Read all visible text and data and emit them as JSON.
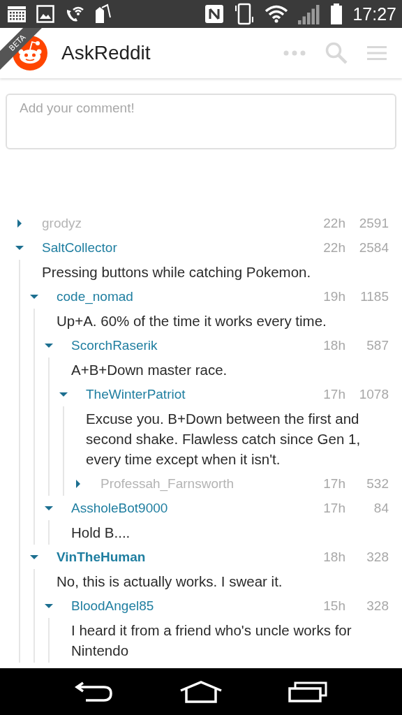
{
  "status_bar": {
    "time": "17:27"
  },
  "app_bar": {
    "badge": "BETA",
    "title": "AskReddit"
  },
  "comment_box": {
    "placeholder": "Add your comment!"
  },
  "comments": [
    {
      "author": "grodyz",
      "age": "22h",
      "score": "2591",
      "expanded": false,
      "op": false
    },
    {
      "author": "SaltCollector",
      "age": "22h",
      "score": "2584",
      "expanded": true,
      "op": false,
      "body": "Pressing buttons while catching Pokemon.",
      "children": [
        {
          "author": "code_nomad",
          "age": "19h",
          "score": "1185",
          "expanded": true,
          "op": false,
          "body": "Up+A. 60% of the time it works every time.",
          "children": [
            {
              "author": "ScorchRaserik",
              "age": "18h",
              "score": "587",
              "expanded": true,
              "op": false,
              "body": "A+B+Down master race.",
              "children": [
                {
                  "author": "TheWinterPatriot",
                  "age": "17h",
                  "score": "1078",
                  "expanded": true,
                  "op": false,
                  "body": "Excuse you. B+Down between the first and second shake. Flawless catch since Gen 1, every time except when it isn't.",
                  "children": [
                    {
                      "author": "Professah_Farnsworth",
                      "age": "17h",
                      "score": "532",
                      "expanded": false,
                      "op": false
                    }
                  ]
                }
              ]
            },
            {
              "author": "AssholeBot9000",
              "age": "17h",
              "score": "84",
              "expanded": true,
              "op": false,
              "body": "Hold B...."
            }
          ]
        },
        {
          "author": "VinTheHuman",
          "age": "18h",
          "score": "328",
          "expanded": true,
          "op": true,
          "body": "No, this is actually works. I swear it.",
          "children": [
            {
              "author": "BloodAngel85",
              "age": "15h",
              "score": "328",
              "expanded": true,
              "op": false,
              "body": "I heard it from a friend who's uncle works for Nintendo"
            }
          ]
        }
      ]
    }
  ]
}
